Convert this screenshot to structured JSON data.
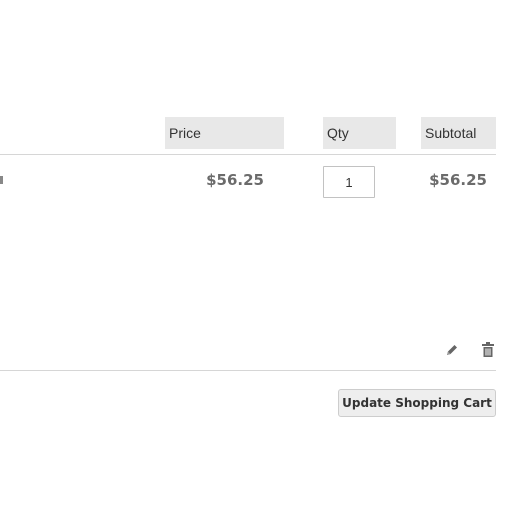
{
  "cart_table": {
    "headers": {
      "price": "Price",
      "qty": "Qty",
      "subtotal": "Subtotal"
    },
    "items": [
      {
        "price": "$56.25",
        "qty": "1",
        "subtotal": "$56.25"
      }
    ]
  },
  "item_actions": {
    "edit_icon": "pencil-icon",
    "delete_icon": "trash-icon"
  },
  "actions": {
    "update_cart_label": "Update Shopping Cart"
  }
}
